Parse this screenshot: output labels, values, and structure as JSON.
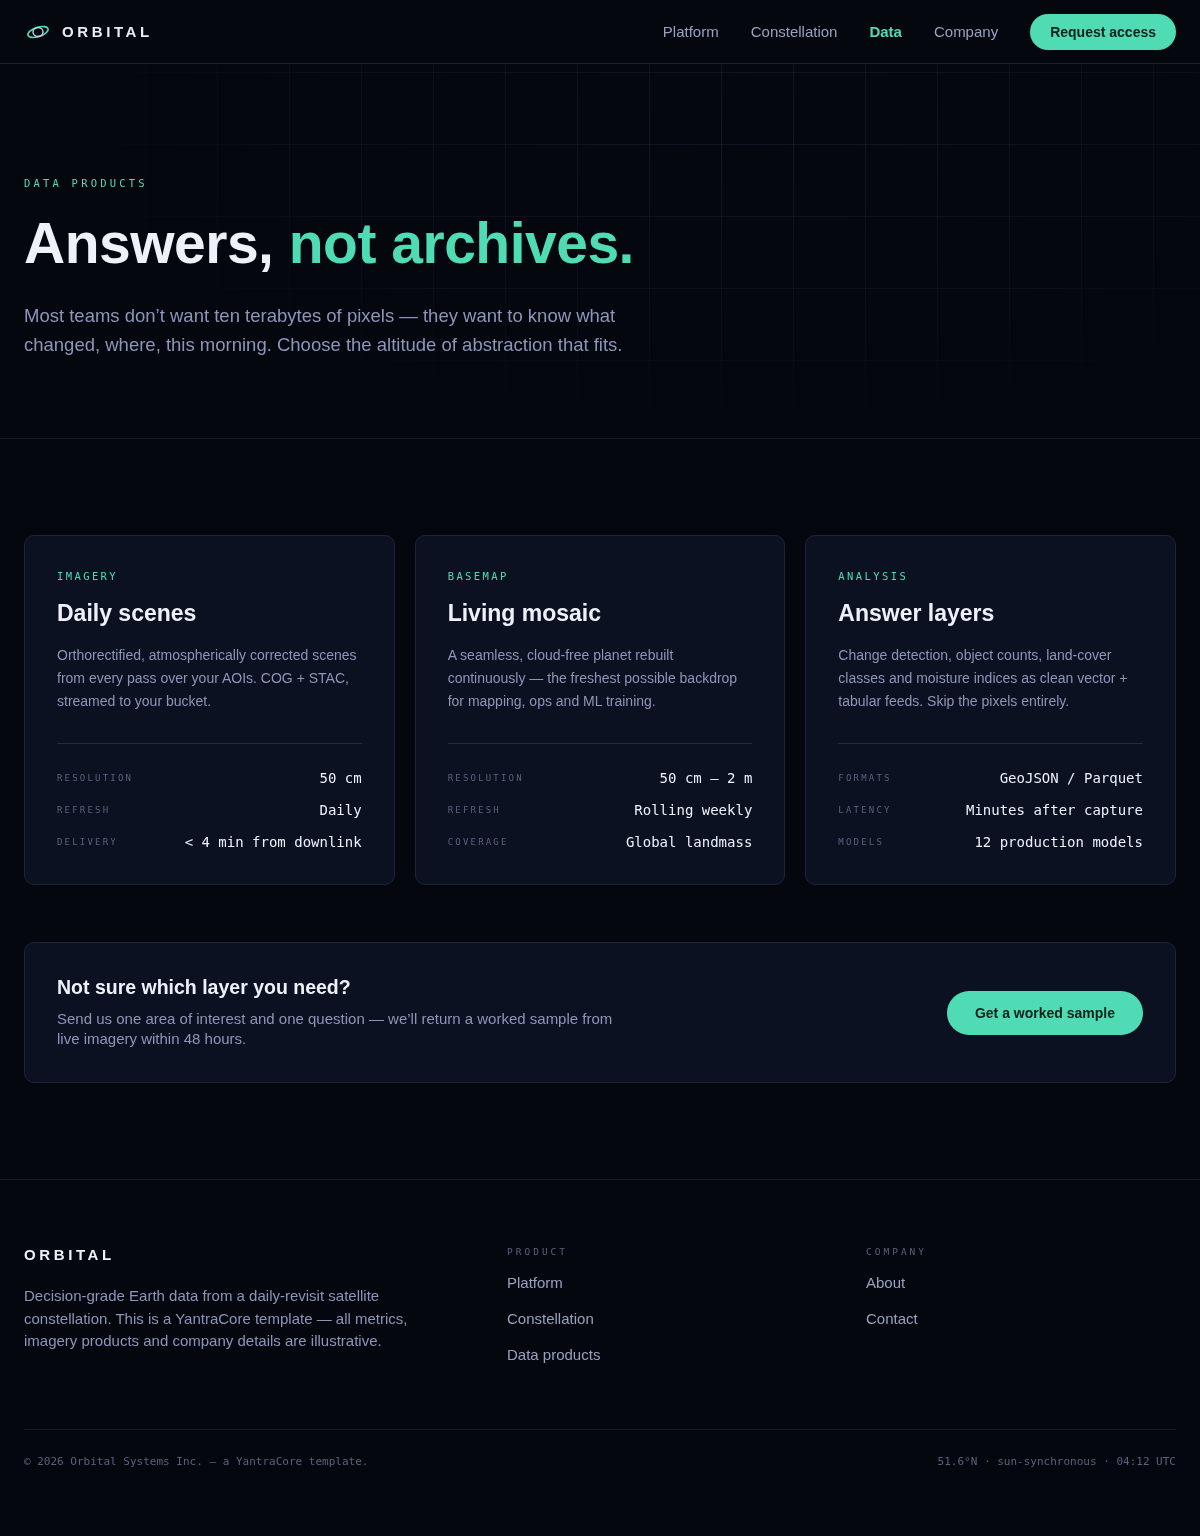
{
  "header": {
    "logo": "ORBITAL",
    "nav": [
      {
        "label": "Platform",
        "selected": false
      },
      {
        "label": "Constellation",
        "selected": false
      },
      {
        "label": "Data",
        "selected": true
      },
      {
        "label": "Company",
        "selected": false
      }
    ],
    "cta": "Request access"
  },
  "hero": {
    "eyebrow": "DATA PRODUCTS",
    "title": "Answers,",
    "title_accent": "not archives.",
    "lead": "Most teams don’t want ten terabytes of pixels — they want to know what changed, where, this morning. Choose the altitude of abstraction that fits."
  },
  "products": [
    {
      "eyebrow": "IMAGERY",
      "title": "Daily scenes",
      "description": "Orthorectified, atmospherically corrected scenes from every pass over your AOIs. COG + STAC, streamed to your bucket.",
      "specs": [
        {
          "label": "RESOLUTION",
          "value": "50 cm"
        },
        {
          "label": "REFRESH",
          "value": "Daily"
        },
        {
          "label": "DELIVERY",
          "value": "< 4 min from downlink"
        }
      ]
    },
    {
      "eyebrow": "BASEMAP",
      "title": "Living mosaic",
      "description": "A seamless, cloud-free planet rebuilt continuously — the freshest possible backdrop for mapping, ops and ML training.",
      "specs": [
        {
          "label": "RESOLUTION",
          "value": "50 cm – 2 m"
        },
        {
          "label": "REFRESH",
          "value": "Rolling weekly"
        },
        {
          "label": "COVERAGE",
          "value": "Global landmass"
        }
      ]
    },
    {
      "eyebrow": "ANALYSIS",
      "title": "Answer layers",
      "description": "Change detection, object counts, land-cover classes and moisture indices as clean vector + tabular feeds. Skip the pixels entirely.",
      "specs": [
        {
          "label": "FORMATS",
          "value": "GeoJSON / Parquet"
        },
        {
          "label": "LATENCY",
          "value": "Minutes after capture"
        },
        {
          "label": "MODELS",
          "value": "12 production models"
        }
      ]
    }
  ],
  "sample_cta": {
    "title": "Not sure which layer you need?",
    "text": "Send us one area of interest and one question — we’ll return a worked sample from live imagery within 48 hours.",
    "button": "Get a worked sample"
  },
  "footer": {
    "brand": "ORBITAL",
    "description": "Decision-grade Earth data from a daily-revisit satellite constellation. This is a YantraCore template — all metrics, imagery products and company details are illustrative.",
    "columns": [
      {
        "heading": "PRODUCT",
        "links": [
          "Platform",
          "Constellation",
          "Data products"
        ]
      },
      {
        "heading": "COMPANY",
        "links": [
          "About",
          "Contact"
        ]
      }
    ],
    "copyright": "© 2026 Orbital Systems Inc. — a YantraCore template.",
    "status": "51.6°N · sun-synchronous · 04:12 UTC"
  }
}
